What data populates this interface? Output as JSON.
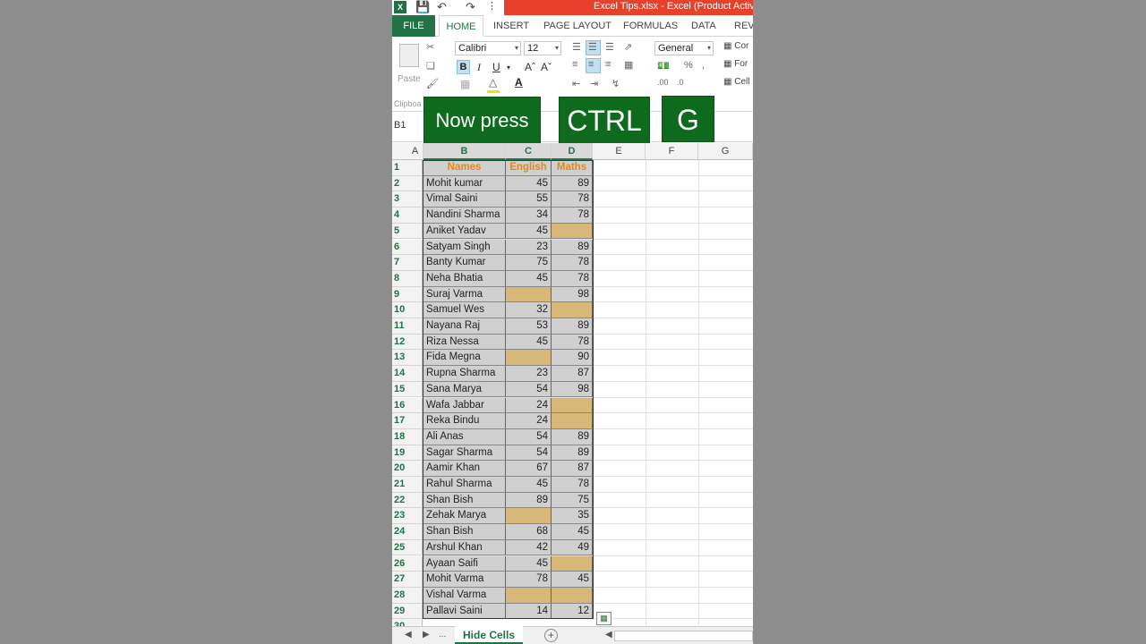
{
  "window": {
    "title": "Excel Tips.xlsx - Excel (Product Activ"
  },
  "ribbon": {
    "tabs": [
      "FILE",
      "HOME",
      "INSERT",
      "PAGE LAYOUT",
      "FORMULAS",
      "DATA",
      "REV"
    ],
    "paste_label": "Paste",
    "clipboard_label": "Clipboa",
    "font_name": "Calibri",
    "font_size": "12",
    "number_format": "General",
    "side_buttons": [
      "Cor",
      "For",
      "Cell"
    ]
  },
  "formula_bar": {
    "name_box": "B1"
  },
  "overlay": {
    "key1": "Now press",
    "key2": "CTRL",
    "key3": "G"
  },
  "columns": [
    "A",
    "B",
    "C",
    "D",
    "E",
    "F",
    "G"
  ],
  "row_numbers": [
    "1",
    "2",
    "3",
    "4",
    "5",
    "6",
    "7",
    "8",
    "9",
    "10",
    "11",
    "12",
    "13",
    "14",
    "15",
    "16",
    "17",
    "18",
    "19",
    "20",
    "21",
    "22",
    "23",
    "24",
    "25",
    "26",
    "27",
    "28",
    "29",
    "30"
  ],
  "table": {
    "headers": [
      "Names",
      "English",
      "Maths"
    ],
    "rows": [
      [
        "Mohit kumar",
        "45",
        "89"
      ],
      [
        "Vimal Saini",
        "55",
        "78"
      ],
      [
        "Nandini Sharma",
        "34",
        "78"
      ],
      [
        "Aniket Yadav",
        "45",
        ""
      ],
      [
        "Satyam Singh",
        "23",
        "89"
      ],
      [
        "Banty Kumar",
        "75",
        "78"
      ],
      [
        "Neha Bhatia",
        "45",
        "78"
      ],
      [
        "Suraj Varma",
        "",
        "98"
      ],
      [
        "Samuel Wes",
        "32",
        ""
      ],
      [
        "Nayana Raj",
        "53",
        "89"
      ],
      [
        "Riza Nessa",
        "45",
        "78"
      ],
      [
        "Fida Megna",
        "",
        "90"
      ],
      [
        "Rupna Sharma",
        "23",
        "87"
      ],
      [
        "Sana Marya",
        "54",
        "98"
      ],
      [
        "Wafa Jabbar",
        "24",
        ""
      ],
      [
        "Reka Bindu",
        "24",
        ""
      ],
      [
        "Ali Anas",
        "54",
        "89"
      ],
      [
        "Sagar Sharma",
        "54",
        "89"
      ],
      [
        "Aamir Khan",
        "67",
        "87"
      ],
      [
        "Rahul Sharma",
        "45",
        "78"
      ],
      [
        "Shan Bish",
        "89",
        "75"
      ],
      [
        "Zehak Marya",
        "",
        "35"
      ],
      [
        "Shan Bish",
        "68",
        "45"
      ],
      [
        "Arshul Khan",
        "42",
        "49"
      ],
      [
        "Ayaan Saifi",
        "45",
        ""
      ],
      [
        "Mohit Varma",
        "78",
        "45"
      ],
      [
        "Vishal Varma",
        "",
        ""
      ],
      [
        "Pallavi Saini",
        "14",
        "12"
      ]
    ]
  },
  "sheet_tabs": {
    "active": "Hide Cells",
    "more": "..."
  },
  "colors": {
    "excel_green": "#217346",
    "header_orange": "#e0891c",
    "blank_fill": "#d8b878",
    "overlay_green": "#0e6b1d"
  }
}
